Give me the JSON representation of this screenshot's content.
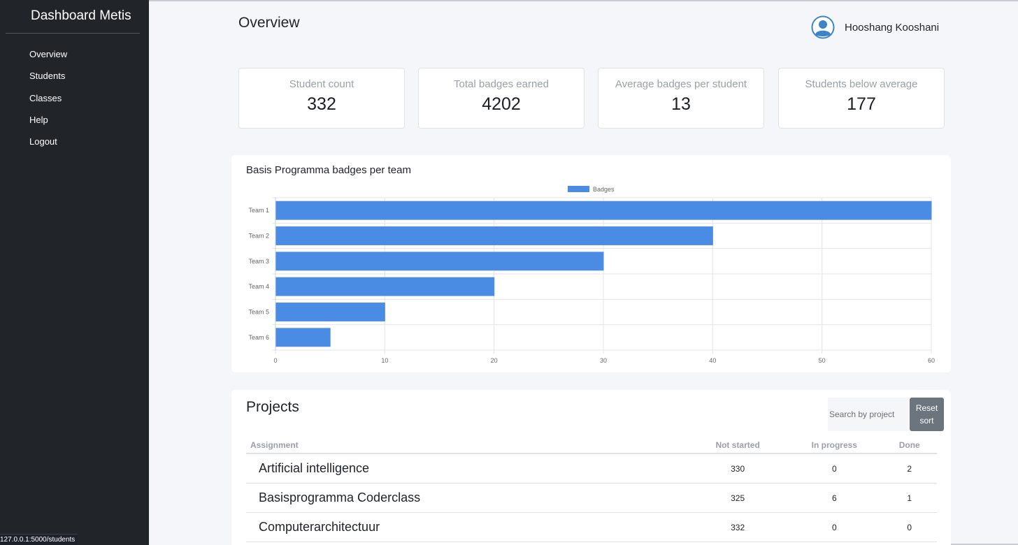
{
  "app": {
    "brand": "Dashboard Metis",
    "status_url": "127.0.0.1:5000/students"
  },
  "sidebar": {
    "items": [
      {
        "label": "Overview"
      },
      {
        "label": "Students"
      },
      {
        "label": "Classes"
      },
      {
        "label": "Help"
      },
      {
        "label": "Logout"
      }
    ]
  },
  "header": {
    "title": "Overview",
    "user_name": "Hooshang Kooshani"
  },
  "stats": [
    {
      "label": "Student count",
      "value": "332"
    },
    {
      "label": "Total badges earned",
      "value": "4202"
    },
    {
      "label": "Average badges per student",
      "value": "13"
    },
    {
      "label": "Students below average",
      "value": "177"
    }
  ],
  "chart_data": {
    "type": "bar",
    "orientation": "horizontal",
    "title": "Basis Programma badges per team",
    "categories": [
      "Team 1",
      "Team 2",
      "Team 3",
      "Team 4",
      "Team 5",
      "Team 6"
    ],
    "series": [
      {
        "name": "Badges",
        "values": [
          60,
          40,
          30,
          20,
          10,
          5
        ]
      }
    ],
    "xlim": [
      0,
      60
    ],
    "xticks": [
      0,
      10,
      20,
      30,
      40,
      50,
      60
    ],
    "grid": true,
    "legend": "top-center",
    "bar_color": "#4a8be3"
  },
  "projects": {
    "title": "Projects",
    "search_placeholder": "Search by project",
    "reset_label": "Reset sort",
    "columns": [
      "Assignment",
      "Not started",
      "In progress",
      "Done"
    ],
    "rows": [
      {
        "assignment": "Artificial intelligence",
        "not_started": "330",
        "in_progress": "0",
        "done": "2"
      },
      {
        "assignment": "Basisprogramma Coderclass",
        "not_started": "325",
        "in_progress": "6",
        "done": "1"
      },
      {
        "assignment": "Computerarchitectuur",
        "not_started": "332",
        "in_progress": "0",
        "done": "0"
      }
    ]
  },
  "colors": {
    "sidebar_bg": "#212529",
    "page_bg": "#f5f6f9",
    "accent": "#4a8be3",
    "button_bg": "#6c757d"
  }
}
